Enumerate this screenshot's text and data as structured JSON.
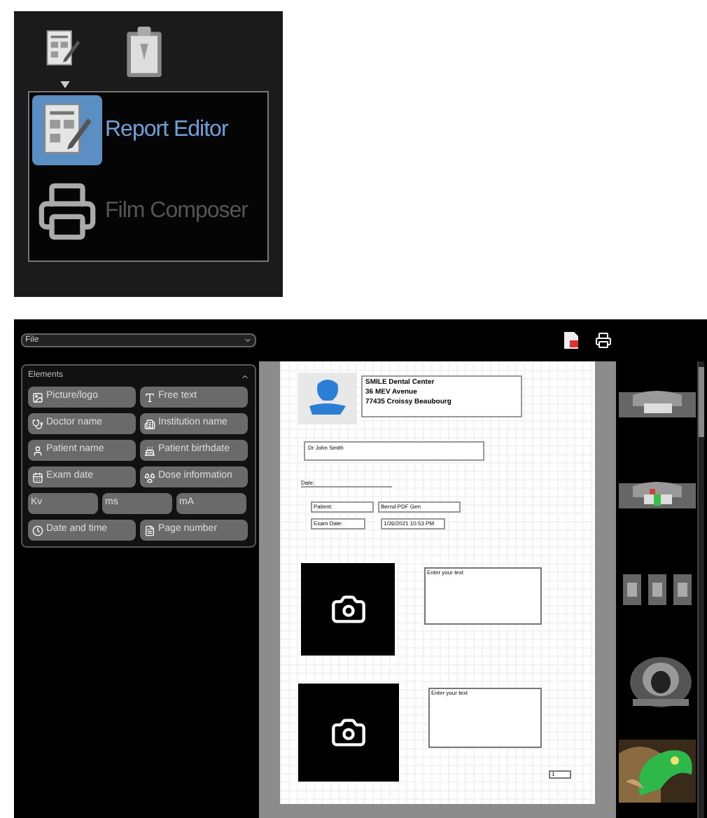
{
  "launcher": {
    "menu": [
      {
        "label": "Report Editor",
        "selected": true
      },
      {
        "label": "Film Composer",
        "selected": false
      }
    ]
  },
  "toolbar": {
    "file_select": "File"
  },
  "elements_panel": {
    "title": "Elements",
    "expanded": true,
    "items": [
      {
        "label": "Picture/logo",
        "kind": "icon"
      },
      {
        "label": "Free text",
        "kind": "icon"
      },
      {
        "label": "Doctor name",
        "kind": "icon"
      },
      {
        "label": "Institution name",
        "kind": "icon"
      },
      {
        "label": "Patient name",
        "kind": "icon"
      },
      {
        "label": "Patient birthdate",
        "kind": "icon"
      },
      {
        "label": "Exam date",
        "kind": "icon"
      },
      {
        "label": "Dose information",
        "kind": "icon"
      },
      {
        "label": "Kv",
        "kind": "plain"
      },
      {
        "label": "ms",
        "kind": "plain"
      },
      {
        "label": "mA",
        "kind": "plain"
      },
      {
        "label": "Date and time",
        "kind": "icon"
      },
      {
        "label": "Page number",
        "kind": "icon"
      }
    ]
  },
  "document": {
    "header_lines": [
      "SMILE Dental Center",
      "36 MEV Avenue",
      "77435 Croissy Beaubourg"
    ],
    "doctor": "Dr John Smith",
    "date_label": "Date:",
    "fields": [
      {
        "label": "Patient:",
        "value": "Bernd PDF Gen"
      },
      {
        "label": "Exam Date:",
        "value": "1/26/2021 10:53 PM"
      }
    ],
    "photo_blocks": [
      {
        "text": "Enter your text"
      },
      {
        "text": "Enter your text"
      }
    ],
    "page_number": "1"
  }
}
